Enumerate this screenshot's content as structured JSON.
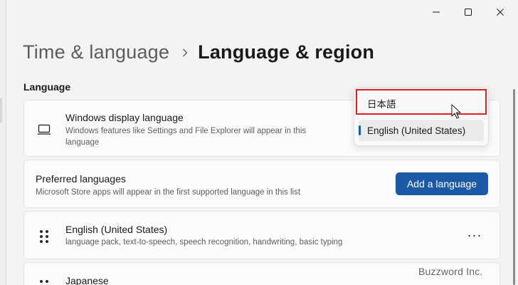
{
  "window": {
    "caption": {
      "minimize_icon": "minimize-icon",
      "maximize_icon": "maximize-icon",
      "close_icon": "close-icon"
    }
  },
  "breadcrumb": {
    "parent": "Time & language",
    "separator_icon": "chevron-right-icon",
    "current": "Language & region"
  },
  "section": {
    "title": "Language"
  },
  "display_language": {
    "icon": "monitor-icon",
    "title": "Windows display language",
    "description": "Windows features like Settings and File Explorer will appear in this language",
    "dropdown": {
      "options": [
        {
          "label": "日本語",
          "selected": false,
          "highlighted": true
        },
        {
          "label": "English (United States)",
          "selected": true,
          "highlighted": false
        }
      ]
    }
  },
  "preferred_languages": {
    "title": "Preferred languages",
    "description": "Microsoft Store apps will appear in the first supported language in this list",
    "add_button_label": "Add a language"
  },
  "languages": [
    {
      "name": "English (United States)",
      "features": "language pack, text-to-speech, speech recognition, handwriting, basic typing",
      "more_label": "···"
    },
    {
      "name": "Japanese"
    }
  ],
  "watermark": "Buzzword Inc.",
  "colors": {
    "accent": "#1c5aa8",
    "highlight": "#e02020",
    "background": "#f3f3f3"
  }
}
